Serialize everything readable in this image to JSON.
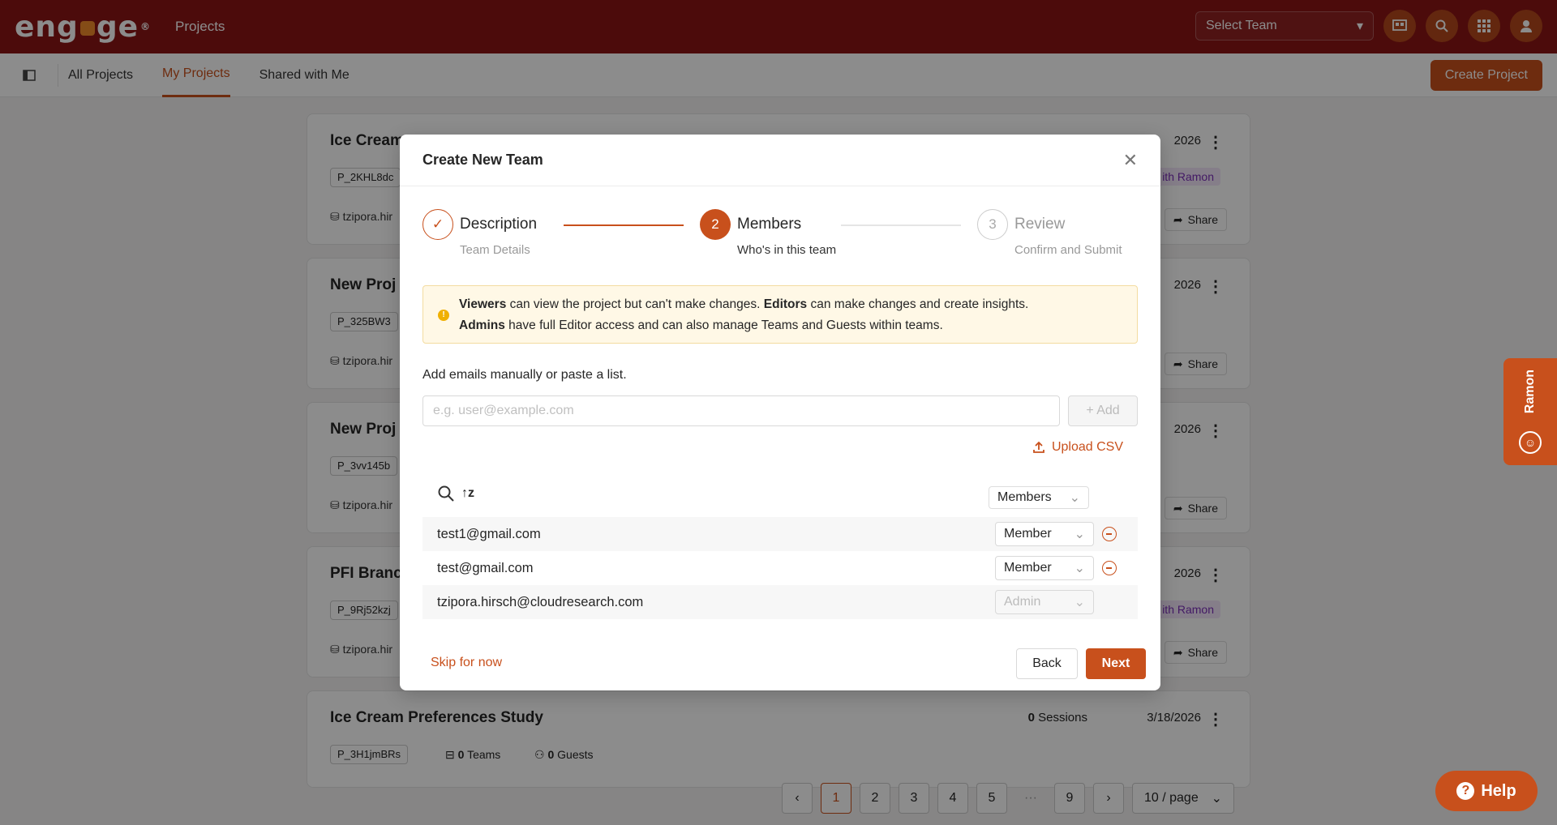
{
  "app": {
    "logo": "engage",
    "section": "Projects"
  },
  "topbar": {
    "team_select": "Select Team"
  },
  "subnav": {
    "tabs": [
      "All Projects",
      "My Projects",
      "Shared with Me"
    ],
    "create_label": "Create Project"
  },
  "cards": [
    {
      "title": "Ice Cream",
      "code": "P_2KHL8dc",
      "owner": "tzipora.hir",
      "date": "2026",
      "tag": "ith Ramon",
      "share": "Share"
    },
    {
      "title": "New Proj",
      "code": "P_325BW3",
      "owner": "tzipora.hir",
      "date": "2026",
      "share": "Share"
    },
    {
      "title": "New Proj",
      "code": "P_3vv145b",
      "owner": "tzipora.hir",
      "date": "2026",
      "share": "Share"
    },
    {
      "title": "PFI Branc",
      "code": "P_9Rj52kzj",
      "owner": "tzipora.hir",
      "date": "2026",
      "tag": "ith Ramon",
      "share": "Share"
    },
    {
      "title": "Ice Cream Preferences Study",
      "code": "P_3H1jmBRs",
      "sessions": "0",
      "sessions_label": "Sessions",
      "date": "3/18/2026",
      "teams": "0",
      "teams_label": "Teams",
      "guests": "0",
      "guests_label": "Guests"
    }
  ],
  "pagination": {
    "pages": [
      "1",
      "2",
      "3",
      "4",
      "5",
      "9"
    ],
    "ellipsis": "···",
    "active": "1",
    "page_size": "10 / page"
  },
  "help": {
    "label": "Help"
  },
  "side_tab": {
    "label": "Ramon"
  },
  "modal": {
    "title": "Create New Team",
    "steps": [
      {
        "num": "",
        "label": "Description",
        "sub": "Team Details"
      },
      {
        "num": "2",
        "label": "Members",
        "sub": "Who's in this team"
      },
      {
        "num": "3",
        "label": "Review",
        "sub": "Confirm and Submit"
      }
    ],
    "alert": {
      "viewers": "Viewers",
      "viewers_text": " can view the project but can't make changes. ",
      "editors": "Editors",
      "editors_text": " can make changes and create insights.",
      "admins": "Admins",
      "admins_text": " have full Editor access and can also manage Teams and Guests within teams."
    },
    "add_label": "Add emails manually or paste a list.",
    "email_placeholder": "e.g. user@example.com",
    "add_button": "+ Add",
    "upload_csv": "Upload CSV",
    "filter": "Members",
    "members": [
      {
        "email": "test1@gmail.com",
        "role": "Member"
      },
      {
        "email": "test@gmail.com",
        "role": "Member"
      },
      {
        "email": "tzipora.hirsch@cloudresearch.com",
        "role": "Admin"
      }
    ],
    "skip": "Skip for now",
    "back": "Back",
    "next": "Next"
  },
  "colors": {
    "brand": "#8a1414",
    "accent": "#c8501c"
  }
}
